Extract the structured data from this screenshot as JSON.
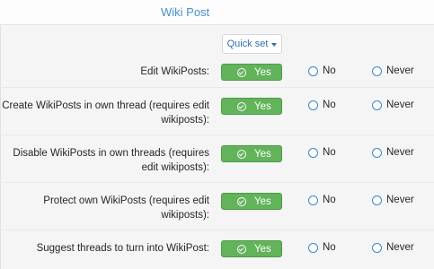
{
  "header": {
    "title": "Wiki Post"
  },
  "quickset": {
    "label": "Quick set"
  },
  "rows": [
    {
      "label": "Edit WikiPosts:",
      "yes": "Yes",
      "no": "No",
      "never": "Never"
    },
    {
      "label": "Create WikiPosts in own thread (requires edit wikiposts):",
      "yes": "Yes",
      "no": "No",
      "never": "Never"
    },
    {
      "label": "Disable WikiPosts in own threads (requires edit wikiposts):",
      "yes": "Yes",
      "no": "No",
      "never": "Never"
    },
    {
      "label": "Protect own WikiPosts (requires edit wikiposts):",
      "yes": "Yes",
      "no": "No",
      "never": "Never"
    },
    {
      "label": "Suggest threads to turn into WikiPost:",
      "yes": "Yes",
      "no": "No",
      "never": "Never"
    }
  ],
  "colors": {
    "accent": "#4a90c8",
    "yes_bg": "#62b35a",
    "panel_bg": "#f5f5f5"
  },
  "icons": {
    "yes": "check-circle-icon",
    "quickset": "caret-down-icon"
  }
}
